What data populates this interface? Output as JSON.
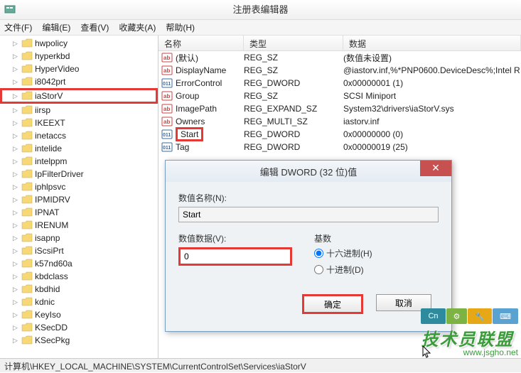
{
  "window": {
    "title": "注册表编辑器"
  },
  "menu": {
    "file": "文件(F)",
    "edit": "编辑(E)",
    "view": "查看(V)",
    "favorites": "收藏夹(A)",
    "help": "帮助(H)"
  },
  "tree": [
    {
      "label": "hwpolicy"
    },
    {
      "label": "hyperkbd"
    },
    {
      "label": "HyperVideo"
    },
    {
      "label": "i8042prt"
    },
    {
      "label": "iaStorV",
      "highlighted": true
    },
    {
      "label": "iirsp"
    },
    {
      "label": "IKEEXT"
    },
    {
      "label": "inetaccs"
    },
    {
      "label": "intelide"
    },
    {
      "label": "intelppm"
    },
    {
      "label": "IpFilterDriver"
    },
    {
      "label": "iphlpsvc"
    },
    {
      "label": "IPMIDRV"
    },
    {
      "label": "IPNAT"
    },
    {
      "label": "IRENUM"
    },
    {
      "label": "isapnp"
    },
    {
      "label": "iScsiPrt"
    },
    {
      "label": "k57nd60a"
    },
    {
      "label": "kbdclass"
    },
    {
      "label": "kbdhid"
    },
    {
      "label": "kdnic"
    },
    {
      "label": "KeyIso"
    },
    {
      "label": "KSecDD"
    },
    {
      "label": "KSecPkg"
    }
  ],
  "columns": {
    "name": "名称",
    "type": "类型",
    "data": "数据"
  },
  "rows": [
    {
      "icon": "str",
      "name": "(默认)",
      "type": "REG_SZ",
      "data": "(数值未设置)"
    },
    {
      "icon": "str",
      "name": "DisplayName",
      "type": "REG_SZ",
      "data": "@iastorv.inf,%*PNP0600.DeviceDesc%;Intel R"
    },
    {
      "icon": "bin",
      "name": "ErrorControl",
      "type": "REG_DWORD",
      "data": "0x00000001 (1)"
    },
    {
      "icon": "str",
      "name": "Group",
      "type": "REG_SZ",
      "data": "SCSI Miniport"
    },
    {
      "icon": "str",
      "name": "ImagePath",
      "type": "REG_EXPAND_SZ",
      "data": "System32\\drivers\\iaStorV.sys"
    },
    {
      "icon": "str",
      "name": "Owners",
      "type": "REG_MULTI_SZ",
      "data": "iastorv.inf"
    },
    {
      "icon": "bin",
      "name": "Start",
      "type": "REG_DWORD",
      "data": "0x00000000 (0)",
      "highlighted": true
    },
    {
      "icon": "bin",
      "name": "Tag",
      "type": "REG_DWORD",
      "data": "0x00000019 (25)"
    }
  ],
  "dialog": {
    "title": "编辑 DWORD (32 位)值",
    "name_label": "数值名称(N):",
    "name_value": "Start",
    "data_label": "数值数据(V):",
    "data_value": "0",
    "base_label": "基数",
    "hex": "十六进制(H)",
    "dec": "十进制(D)",
    "ok": "确定",
    "cancel": "取消"
  },
  "statusbar": "计算机\\HKEY_LOCAL_MACHINE\\SYSTEM\\CurrentControlSet\\Services\\iaStorV",
  "watermark": {
    "text": "技术员联盟",
    "url": "www.jsgho.net",
    "cn": "Cn"
  }
}
